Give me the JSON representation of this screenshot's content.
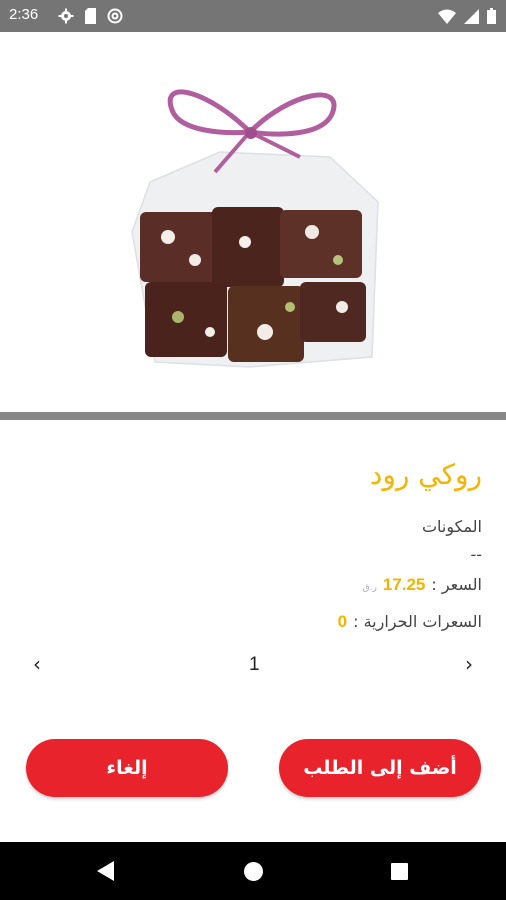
{
  "status_bar": {
    "time": "2:36",
    "left_icons": [
      "gear-icon",
      "sd-card-icon",
      "at-sign-icon"
    ],
    "right_icons": [
      "wifi-icon",
      "cellular-signal-icon",
      "battery-icon"
    ]
  },
  "product": {
    "image_alt": "chocolate-rocky-road-bag",
    "name": "روكي رود",
    "ingredients_label": "المكونات",
    "ingredients_value": "--",
    "price_label": "السعر :",
    "price_value": "17.25",
    "currency": "ر.ق",
    "calories_label": "السعرات الحرارية :",
    "calories_value": "0"
  },
  "quantity": {
    "value": "1",
    "increase_glyph": "‹",
    "decrease_glyph": "›"
  },
  "actions": {
    "add_label": "أضف إلى الطلب",
    "cancel_label": "إلغاء"
  },
  "colors": {
    "accent": "#f5b400",
    "button": "#e8232c",
    "status_bar": "#757575",
    "nav_bar": "#000000"
  },
  "nav": [
    "back-icon",
    "home-icon",
    "recents-icon"
  ]
}
